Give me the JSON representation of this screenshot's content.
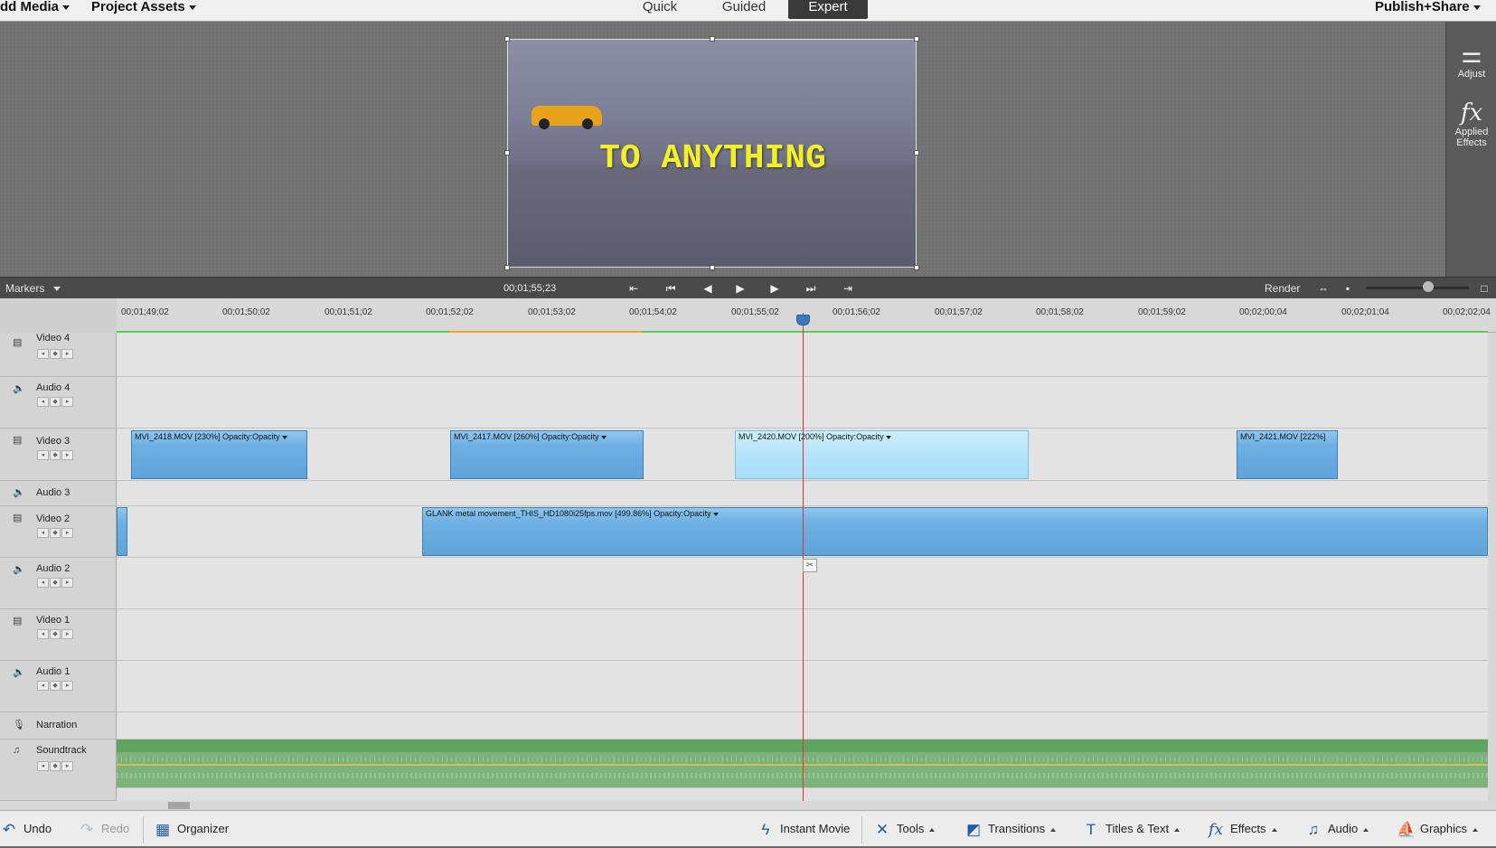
{
  "topbar": {
    "add_media": "dd Media",
    "project_assets": "Project Assets",
    "modes": [
      "Quick",
      "Guided",
      "Expert"
    ],
    "active_mode": "Expert",
    "publish_share": "Publish+Share"
  },
  "monitor": {
    "overlay_text": "TO ANYTHING"
  },
  "right_panel": {
    "adjust_label": "Adjust",
    "applied_effects_label": "Applied Effects",
    "fx_symbol": "fx"
  },
  "transport": {
    "markers_label": "Markers",
    "timecode": "00;01;55;23",
    "render_label": "Render"
  },
  "ruler": {
    "ticks": [
      "00;01;49;02",
      "00;01;50;02",
      "00;01;51;02",
      "00;01;52;02",
      "00;01;53;02",
      "00;01;54;02",
      "00;01;55;02",
      "00;01;56;02",
      "00;01;57;02",
      "00;01;58;02",
      "00;01;59;02",
      "00;02;00;04",
      "00;02;01;04",
      "00;02;02;04"
    ]
  },
  "tracks": [
    {
      "name": "Video 4",
      "type": "video"
    },
    {
      "name": "Audio 4",
      "type": "audio"
    },
    {
      "name": "Video 3",
      "type": "video"
    },
    {
      "name": "Audio 3",
      "type": "audio"
    },
    {
      "name": "Video 2",
      "type": "video"
    },
    {
      "name": "Audio 2",
      "type": "audio"
    },
    {
      "name": "Video 1",
      "type": "video"
    },
    {
      "name": "Audio 1",
      "type": "audio"
    },
    {
      "name": "Narration",
      "type": "narration"
    },
    {
      "name": "Soundtrack",
      "type": "soundtrack"
    }
  ],
  "clips": {
    "v3_a": {
      "name": "MVI_2418.MOV [230%]",
      "property": "Opacity:Opacity"
    },
    "v3_b": {
      "name": "MVI_2417.MOV [260%]",
      "property": "Opacity:Opacity"
    },
    "v3_c": {
      "name": "MVI_2420.MOV [200%]",
      "property": "Opacity:Opacity"
    },
    "v3_d": {
      "name": "MVI_2421.MOV [222%]",
      "property": ""
    },
    "v2_a": {
      "name": "GLANK metal movement_THIS_HD1080i25fps.mov [499.86%]",
      "property": "Opacity:Opacity"
    }
  },
  "bottombar": {
    "undo": "Undo",
    "redo": "Redo",
    "organizer": "Organizer",
    "instant_movie": "Instant Movie",
    "tools": "Tools",
    "transitions": "Transitions",
    "titles_text": "Titles & Text",
    "effects": "Effects",
    "audio": "Audio",
    "graphics": "Graphics"
  }
}
